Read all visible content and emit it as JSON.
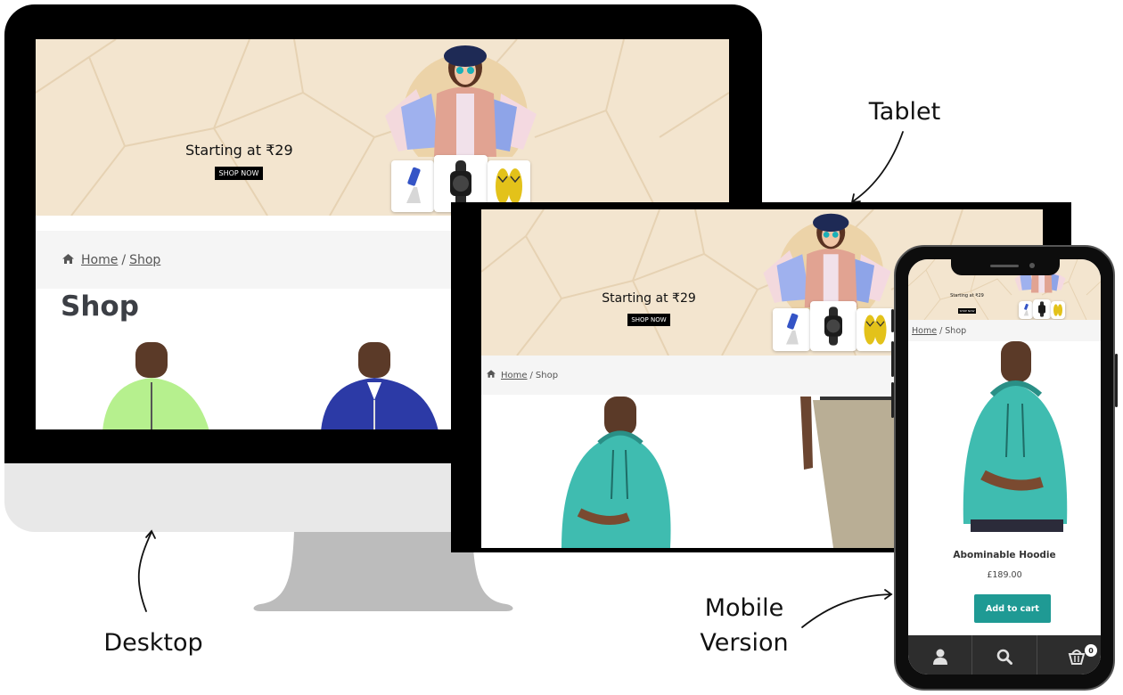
{
  "labels": {
    "desktop": "Desktop",
    "tablet": "Tablet",
    "mobile_line1": "Mobile",
    "mobile_line2": "Version"
  },
  "hero": {
    "title": "Starting at ₹29",
    "cta": "SHOP NOW",
    "product_thumbs": [
      "phone-stand",
      "smartwatch",
      "flip-flops"
    ]
  },
  "desktop": {
    "breadcrumb": {
      "home": "Home",
      "separator": "/",
      "current": "Shop"
    },
    "page_title": "Shop",
    "products": [
      {
        "name": "green-quarter-zip",
        "color": "#b6f08e"
      },
      {
        "name": "blue-track-jacket",
        "color": "#2c3aa6"
      }
    ]
  },
  "tablet": {
    "breadcrumb": {
      "home": "Home",
      "separator": "/",
      "current": "Shop"
    },
    "products": [
      {
        "name": "teal-hoodie",
        "color": "#3fbcb0"
      },
      {
        "name": "khaki-pants",
        "color": "#b9ae95"
      }
    ]
  },
  "mobile": {
    "breadcrumb": {
      "home": "Home",
      "separator": "/",
      "current": "Shop"
    },
    "product": {
      "title": "Abominable Hoodie",
      "price": "£189.00",
      "add_to_cart": "Add to cart"
    },
    "footer": {
      "items": [
        "account-icon",
        "search-icon",
        "cart-icon"
      ],
      "cart_count": "0"
    }
  },
  "colors": {
    "hero_bg": "#f3e5cf",
    "accent_teal": "#1f9a94",
    "footer_bg": "#2d2d2d"
  }
}
